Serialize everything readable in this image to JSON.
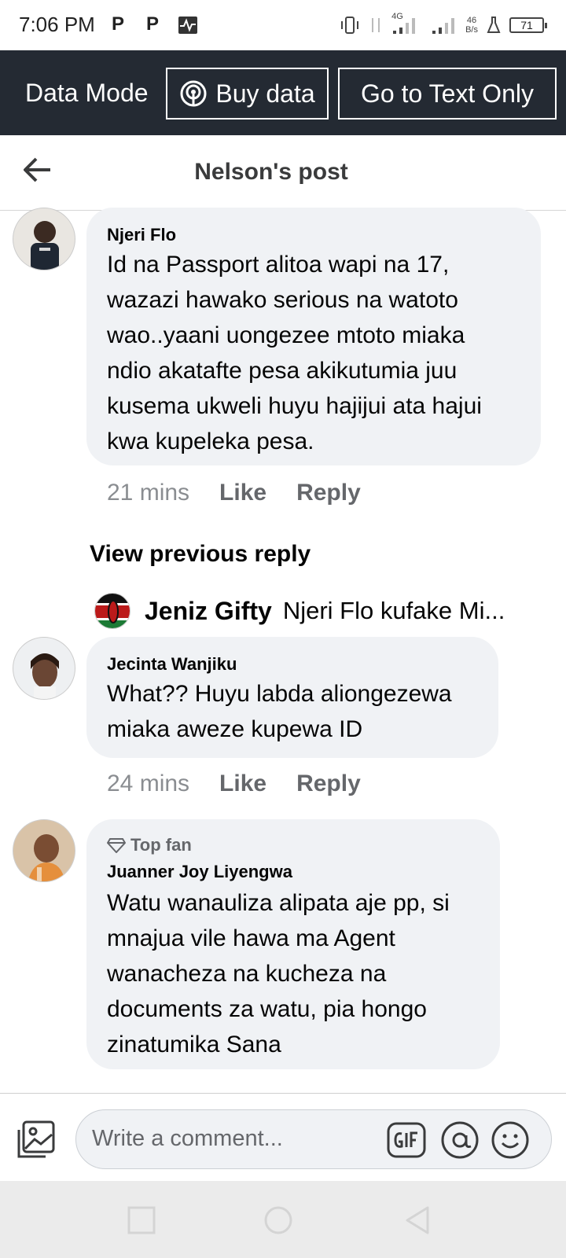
{
  "status_bar": {
    "time": "7:06 PM",
    "net_type": "4G",
    "speed_value": "46",
    "speed_unit": "B/s",
    "battery": "71"
  },
  "data_mode": {
    "label": "Data Mode",
    "buy_label": "Buy data",
    "text_only_label": "Go to Text Only"
  },
  "header": {
    "title": "Nelson's post"
  },
  "comments": [
    {
      "name": "Njeri Flo",
      "text_lines": [
        "Id na Passport alitoa wapi na 17,",
        "wazazi hawako serious na watoto",
        "wao..yaani uongezee mtoto miaka",
        "ndio akatafte pesa akikutumia juu",
        "kusema ukweli huyu hajijui ata hajui",
        "kwa kupeleka pesa."
      ],
      "time": "21 mins",
      "like": "Like",
      "reply": "Reply"
    },
    {
      "name": "Jecinta Wanjiku",
      "text_lines": [
        "What?? Huyu labda aliongezewa",
        "miaka aweze kupewa ID"
      ],
      "time": "24 mins",
      "like": "Like",
      "reply": "Reply"
    },
    {
      "badge": "Top fan",
      "name": "Juanner Joy Liyengwa",
      "text_lines": [
        "Watu wanauliza alipata aje pp, si",
        "mnajua vile hawa ma Agent",
        "wanacheza na kucheza na",
        "documents za watu, pia hongo",
        "zinatumika Sana"
      ]
    }
  ],
  "view_previous": "View previous reply",
  "reply_preview": {
    "name": "Jeniz Gifty",
    "text": "Njeri Flo kufake Mi..."
  },
  "composer": {
    "placeholder": "Write a comment..."
  },
  "colors": {
    "data_bar_bg": "#242a33",
    "bubble_bg": "#f0f2f5",
    "meta_text": "#65676b"
  }
}
